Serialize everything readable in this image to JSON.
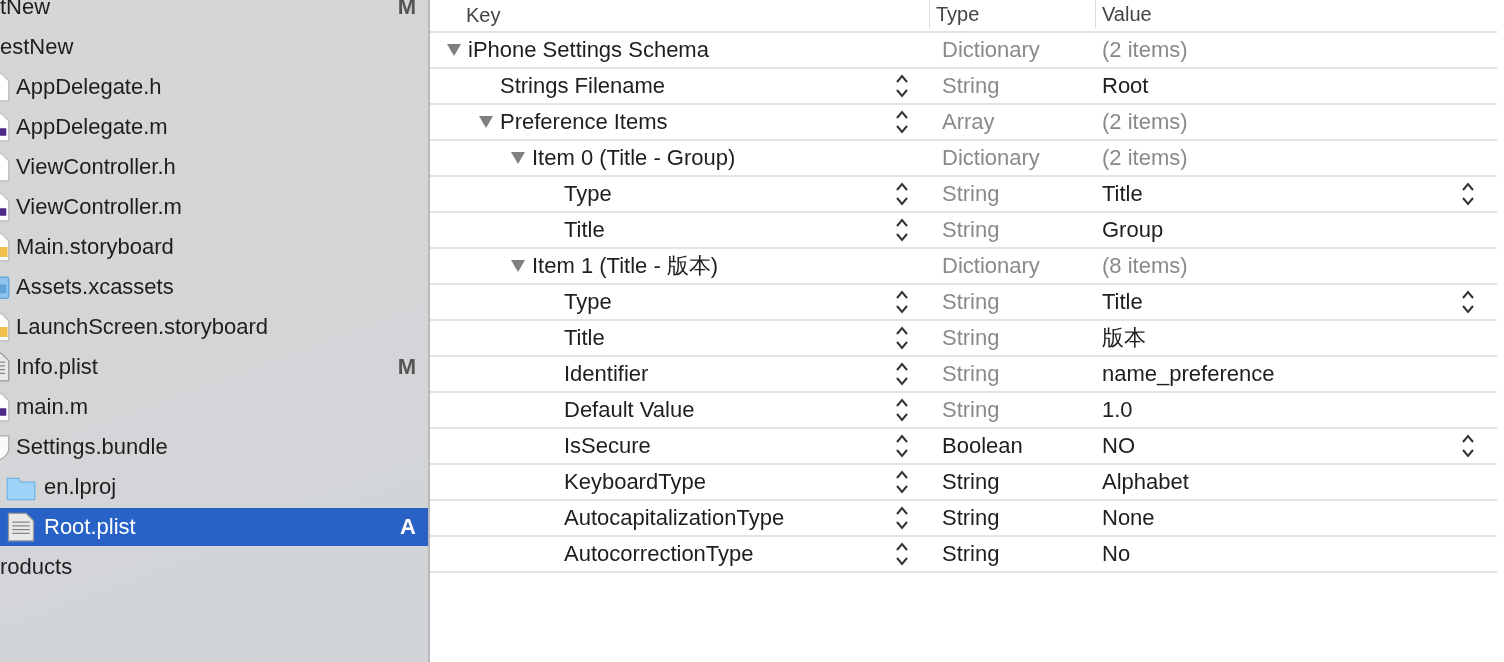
{
  "navigator": {
    "items": [
      {
        "label": "tNew",
        "badge": "M",
        "selected": false,
        "children": [
          {
            "label": "estNew",
            "selected": false,
            "children": [
              {
                "label": "AppDelegate.h",
                "kind": "header",
                "selected": false
              },
              {
                "label": "AppDelegate.m",
                "kind": "source",
                "selected": false
              },
              {
                "label": "ViewController.h",
                "kind": "header",
                "selected": false
              },
              {
                "label": "ViewController.m",
                "kind": "source",
                "selected": false
              },
              {
                "label": "Main.storyboard",
                "kind": "storyboard",
                "selected": false
              },
              {
                "label": "Assets.xcassets",
                "kind": "assets",
                "selected": false
              },
              {
                "label": "LaunchScreen.storyboard",
                "kind": "storyboard",
                "selected": false
              },
              {
                "label": "Info.plist",
                "kind": "plist",
                "badge": "M",
                "selected": false
              },
              {
                "label": "main.m",
                "kind": "source",
                "selected": false
              },
              {
                "label": "Settings.bundle",
                "kind": "bundle",
                "selected": false,
                "children": [
                  {
                    "label": "en.lproj",
                    "kind": "folder",
                    "selected": false
                  },
                  {
                    "label": "Root.plist",
                    "kind": "plist",
                    "badge": "A",
                    "selected": true
                  }
                ]
              }
            ]
          },
          {
            "label": "roducts",
            "selected": false
          }
        ]
      }
    ]
  },
  "plist": {
    "columns": [
      "Key",
      "Type",
      "Value"
    ],
    "rows": [
      {
        "key": "iPhone Settings Schema",
        "type": "Dictionary",
        "value": "(2 items)",
        "expanded": true,
        "key_stepper": false,
        "type_dimmed": true,
        "value_dimmed": true,
        "value_stepper": false,
        "children": [
          {
            "key": "Strings Filename",
            "type": "String",
            "value": "Root",
            "key_stepper": true,
            "type_dimmed": true,
            "value_dimmed": false,
            "value_stepper": false
          },
          {
            "key": "Preference Items",
            "type": "Array",
            "value": "(2 items)",
            "expanded": true,
            "key_stepper": true,
            "type_dimmed": true,
            "value_dimmed": true,
            "value_stepper": false,
            "children": [
              {
                "key": "Item 0 (Title - Group)",
                "type": "Dictionary",
                "value": "(2 items)",
                "expanded": true,
                "key_stepper": false,
                "type_dimmed": true,
                "value_dimmed": true,
                "value_stepper": false,
                "children": [
                  {
                    "key": "Type",
                    "type": "String",
                    "value": "Title",
                    "key_stepper": true,
                    "type_dimmed": true,
                    "value_dimmed": false,
                    "value_stepper": true
                  },
                  {
                    "key": "Title",
                    "type": "String",
                    "value": "Group",
                    "key_stepper": true,
                    "type_dimmed": true,
                    "value_dimmed": false,
                    "value_stepper": false
                  }
                ]
              },
              {
                "key": "Item 1 (Title - 版本)",
                "type": "Dictionary",
                "value": "(8 items)",
                "expanded": true,
                "key_stepper": false,
                "type_dimmed": true,
                "value_dimmed": true,
                "value_stepper": false,
                "children": [
                  {
                    "key": "Type",
                    "type": "String",
                    "value": "Title",
                    "key_stepper": true,
                    "type_dimmed": true,
                    "value_dimmed": false,
                    "value_stepper": true
                  },
                  {
                    "key": "Title",
                    "type": "String",
                    "value": "版本",
                    "key_stepper": true,
                    "type_dimmed": true,
                    "value_dimmed": false,
                    "value_stepper": false
                  },
                  {
                    "key": "Identifier",
                    "type": "String",
                    "value": "name_preference",
                    "key_stepper": true,
                    "type_dimmed": true,
                    "value_dimmed": false,
                    "value_stepper": false
                  },
                  {
                    "key": "Default Value",
                    "type": "String",
                    "value": "1.0",
                    "key_stepper": true,
                    "type_dimmed": true,
                    "value_dimmed": false,
                    "value_stepper": false
                  },
                  {
                    "key": "IsSecure",
                    "type": "Boolean",
                    "value": "NO",
                    "key_stepper": true,
                    "type_dimmed": false,
                    "value_dimmed": false,
                    "value_stepper": true
                  },
                  {
                    "key": "KeyboardType",
                    "type": "String",
                    "value": "Alphabet",
                    "key_stepper": true,
                    "type_dimmed": false,
                    "value_dimmed": false,
                    "value_stepper": false
                  },
                  {
                    "key": "AutocapitalizationType",
                    "type": "String",
                    "value": "None",
                    "key_stepper": true,
                    "type_dimmed": false,
                    "value_dimmed": false,
                    "value_stepper": false
                  },
                  {
                    "key": "AutocorrectionType",
                    "type": "String",
                    "value": "No",
                    "key_stepper": true,
                    "type_dimmed": false,
                    "value_dimmed": false,
                    "value_stepper": false
                  }
                ]
              }
            ]
          }
        ]
      }
    ]
  }
}
